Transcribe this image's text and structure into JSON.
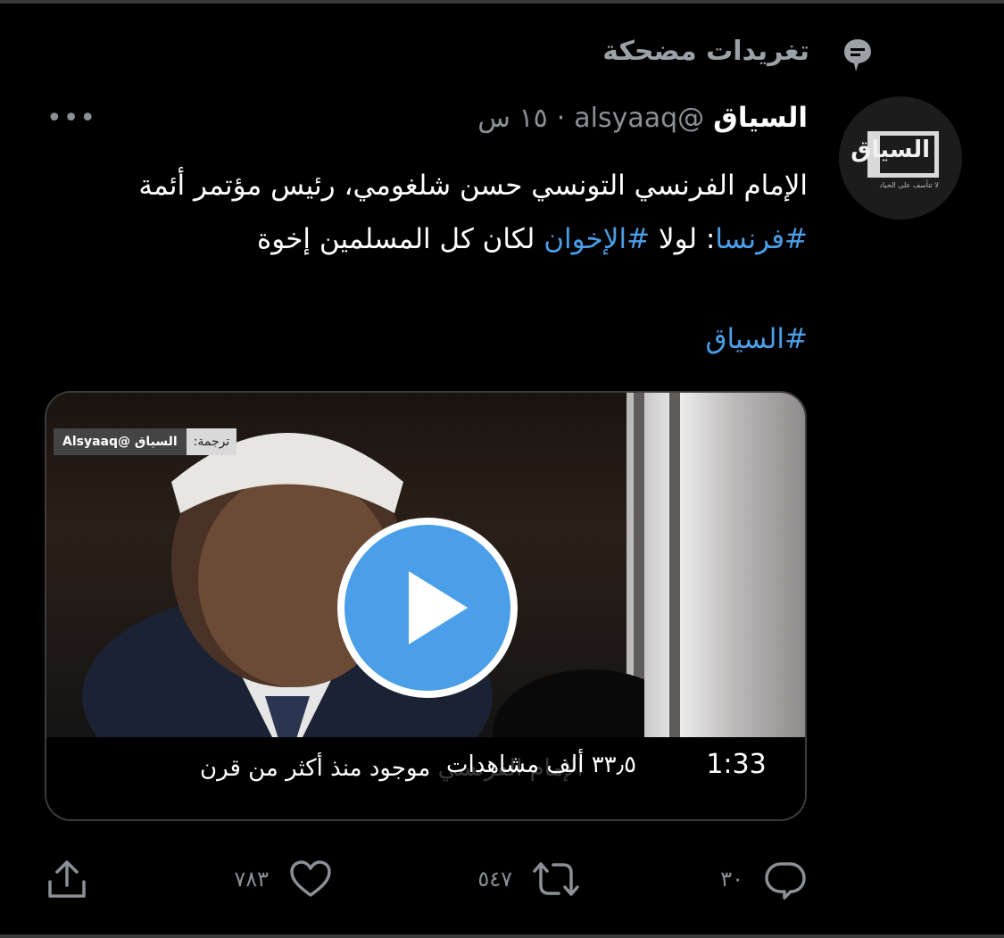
{
  "context": {
    "icon": "topic-bubble-icon",
    "label": "تغريدات مضحكة"
  },
  "tweet": {
    "avatar": {
      "logo_text": "السياق",
      "logo_tagline": "لا تتأسف على الحياد"
    },
    "display_name": "السياق",
    "handle": "@alsyaaq",
    "separator": "·",
    "time": "١٥ س",
    "more_label": "•••",
    "text_line1": "الإمام الفرنسي التونسي حسن شلغومي، رئيس مؤتمر أئمة",
    "hashtag_france": "#فرنسا",
    "text_mid1": ": لولا ",
    "hashtag_ikhwan": "#الإخوان",
    "text_mid2": " لكان كل المسلمين إخوة",
    "hashtag_siyaq": "#السياق"
  },
  "media": {
    "watermark_label": "ترجمة:",
    "watermark_name": "السياق @Alsyaaq",
    "subtitle": "الإمام الفرنسي موجود منذ أكثر من قرن",
    "views": "٣٣٫٥ ألف مشاهدات",
    "duration": "1:33"
  },
  "actions": {
    "reply_count": "٣٠",
    "retweet_count": "٥٤٧",
    "like_count": "٧٨٣"
  },
  "colors": {
    "background": "#000000",
    "link": "#4a9fe8",
    "secondary_text": "#8b9096",
    "play_button": "#4a9fe8"
  }
}
